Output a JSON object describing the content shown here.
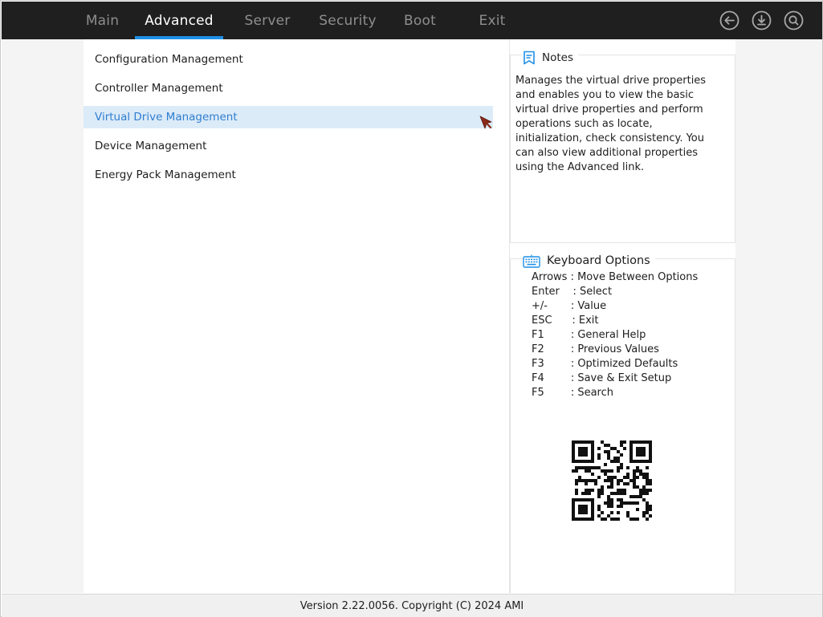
{
  "tabs": [
    {
      "label": "Main"
    },
    {
      "label": "Advanced"
    },
    {
      "label": "Server"
    },
    {
      "label": "Security"
    },
    {
      "label": "Boot"
    },
    {
      "label": "Exit"
    }
  ],
  "active_tab": "Advanced",
  "top_icons": [
    "back-icon",
    "save-download-icon",
    "search-icon"
  ],
  "menu": {
    "items": [
      {
        "label": "Configuration Management"
      },
      {
        "label": "Controller Management"
      },
      {
        "label": "Virtual Drive Management"
      },
      {
        "label": "Device Management"
      },
      {
        "label": "Energy Pack Management"
      }
    ],
    "selected": "Virtual Drive Management"
  },
  "notes": {
    "title": "Notes",
    "text": "Manages the virtual drive properties and enables you to view the basic virtual drive properties and perform operations such as locate, initialization, check consistency. You can also view additional properties using the Advanced link."
  },
  "keyboard": {
    "title": "Keyboard Options",
    "rows": [
      {
        "key": "Arrows ",
        "desc": ": Move Between Options"
      },
      {
        "key": "Enter    ",
        "desc": ": Select"
      },
      {
        "key": "+/-       ",
        "desc": ": Value"
      },
      {
        "key": "ESC      ",
        "desc": ": Exit"
      },
      {
        "key": "F1        ",
        "desc": ": General Help"
      },
      {
        "key": "F2        ",
        "desc": ": Previous Values"
      },
      {
        "key": "F3        ",
        "desc": ": Optimized Defaults"
      },
      {
        "key": "F4        ",
        "desc": ": Save & Exit Setup"
      },
      {
        "key": "F5        ",
        "desc": ": Search"
      }
    ]
  },
  "footer": {
    "text": "Version 2.22.0056. Copyright (C) 2024 AMI"
  },
  "colors": {
    "topbar": "#1f1f1f",
    "accent": "#1e8fe6",
    "selected_bg": "#dcebf8",
    "selected_text": "#2f7ed0",
    "cursor": "#8b2a1a"
  }
}
